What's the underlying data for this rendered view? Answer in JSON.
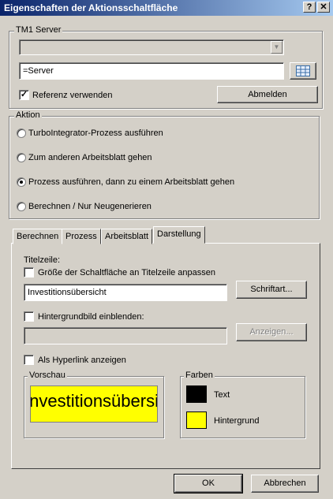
{
  "window": {
    "title": "Eigenschaften der Aktionsschaltfläche",
    "help_label": "?",
    "close_label": "✕"
  },
  "tm1": {
    "group_label": "TM1 Server",
    "server_value": "=Server",
    "use_reference_label": "Referenz verwenden",
    "use_reference_checked": true,
    "logout_label": "Abmelden"
  },
  "action": {
    "group_label": "Aktion",
    "options": [
      {
        "label": "TurboIntegrator-Prozess ausführen",
        "selected": false
      },
      {
        "label": "Zum anderen Arbeitsblatt gehen",
        "selected": false
      },
      {
        "label": "Prozess ausführen, dann zu einem Arbeitsblatt gehen",
        "selected": true
      },
      {
        "label": "Berechnen / Nur Neugenerieren",
        "selected": false
      }
    ]
  },
  "tabs": [
    "Berechnen",
    "Prozess",
    "Arbeitsblatt",
    "Darstellung"
  ],
  "active_tab": "Darstellung",
  "darstellung": {
    "caption_label": "Titelzeile:",
    "fit_label": "Größe der Schaltfläche an Titelzeile anpassen",
    "caption_value": "Investitionsübersicht",
    "font_button_label": "Schriftart...",
    "bg_image_label": "Hintergrundbild einblenden:",
    "show_button_label": "Anzeigen...",
    "hyperlink_label": "Als Hyperlink anzeigen",
    "preview_label": "Vorschau",
    "preview_text": "Investitionsübersicht",
    "colors_label": "Farben",
    "text_color_label": "Text",
    "bg_color_label": "Hintergrund",
    "text_color": "#000000",
    "bg_color": "#ffff00"
  },
  "footer": {
    "ok_label": "OK",
    "cancel_label": "Abbrechen"
  }
}
